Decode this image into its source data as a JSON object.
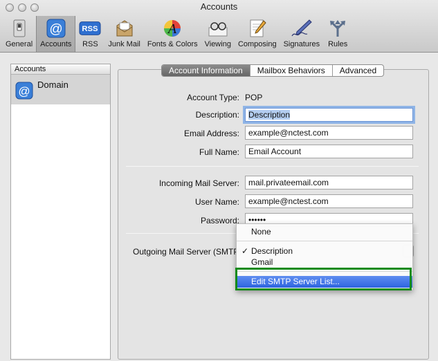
{
  "window": {
    "title": "Accounts"
  },
  "toolbar": {
    "items": [
      {
        "label": "General",
        "icon": "general-switch-icon"
      },
      {
        "label": "Accounts",
        "icon": "at-sign-icon"
      },
      {
        "label": "RSS",
        "icon": "rss-icon",
        "badge": "RSS"
      },
      {
        "label": "Junk Mail",
        "icon": "junk-mail-icon"
      },
      {
        "label": "Fonts & Colors",
        "icon": "fonts-colors-icon",
        "glyph": "A"
      },
      {
        "label": "Viewing",
        "icon": "viewing-glasses-icon"
      },
      {
        "label": "Composing",
        "icon": "composing-pencil-icon"
      },
      {
        "label": "Signatures",
        "icon": "signatures-pen-icon"
      },
      {
        "label": "Rules",
        "icon": "rules-arrows-icon"
      }
    ],
    "active": "Accounts"
  },
  "sidebar": {
    "header": "Accounts",
    "accounts": [
      {
        "name": "Domain",
        "icon": "at-sign-icon"
      }
    ]
  },
  "tabs": [
    {
      "label": "Account Information",
      "selected": true
    },
    {
      "label": "Mailbox Behaviors",
      "selected": false
    },
    {
      "label": "Advanced",
      "selected": false
    }
  ],
  "form": {
    "account_type_label": "Account Type:",
    "account_type_value": "POP",
    "description_label": "Description:",
    "description_value": "Description",
    "email_label": "Email Address:",
    "email_value": "example@nctest.com",
    "fullname_label": "Full Name:",
    "fullname_value": "Email Account",
    "incoming_label": "Incoming Mail Server:",
    "incoming_value": "mail.privateemail.com",
    "username_label": "User Name:",
    "username_value": "example@nctest.com",
    "password_label": "Password:",
    "password_value": "••••••",
    "outgoing_label": "Outgoing Mail Server (SMTP):"
  },
  "smtp_menu": {
    "items": [
      {
        "label": "None",
        "checked": false
      },
      {
        "label": "Description",
        "checked": true
      },
      {
        "label": "Gmail",
        "checked": false
      },
      {
        "label": "Edit SMTP Server List...",
        "highlighted": true
      }
    ],
    "check_glyph": "✓"
  },
  "colors": {
    "highlight": "#2e64e0",
    "annotation_box": "#128a1a",
    "focus_ring": "#8fb4e6"
  }
}
